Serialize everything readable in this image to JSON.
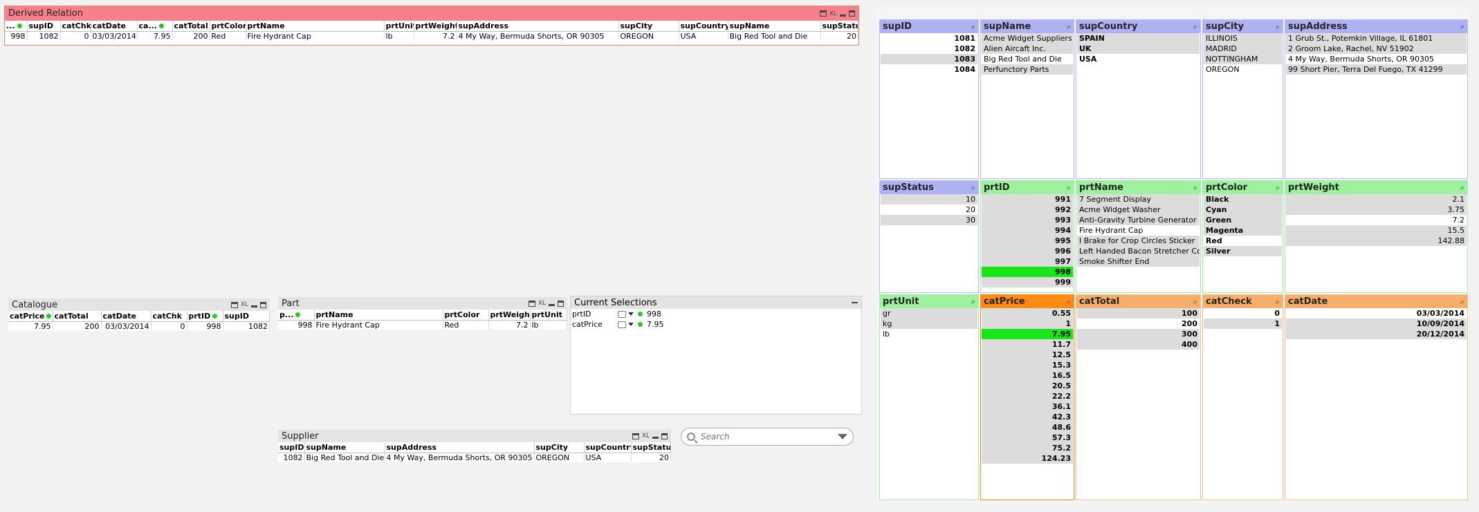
{
  "derived": {
    "title": "Derived Relation",
    "icons": "XL",
    "headers": [
      "...",
      "supID",
      "catChk",
      "catDate",
      "ca...",
      "catTotal",
      "prtColor",
      "prtName",
      "prtUnit",
      "prtWeight",
      "supAddress",
      "supCity",
      "supCountry",
      "supName",
      "supStatus"
    ],
    "row": [
      "998",
      "1082",
      "0",
      "03/03/2014",
      "7.95",
      "200",
      "Red",
      "Fire Hydrant Cap",
      "lb",
      "7.2",
      "4 My Way, Bermuda Shorts, OR 90305",
      "OREGON",
      "USA",
      "Big Red Tool and Die",
      "20"
    ]
  },
  "catalogue": {
    "title": "Catalogue",
    "icons": "XL",
    "headers": [
      "catPrice",
      "catTotal",
      "catDate",
      "catChk",
      "prtID",
      "supID"
    ],
    "row": [
      "7.95",
      "200",
      "03/03/2014",
      "0",
      "998",
      "1082"
    ]
  },
  "part": {
    "title": "Part",
    "icons": "XL",
    "headers": [
      "p...",
      "prtName",
      "prtColor",
      "prtWeight",
      "prtUnit"
    ],
    "row": [
      "998",
      "Fire Hydrant Cap",
      "Red",
      "7.2",
      "lb"
    ]
  },
  "supplier": {
    "title": "Supplier",
    "icons": "XL",
    "headers": [
      "supID",
      "supName",
      "supAddress",
      "supCity",
      "supCountry",
      "supStatus"
    ],
    "row": [
      "1082",
      "Big Red Tool and Die",
      "4 My Way, Bermuda Shorts, OR 90305",
      "OREGON",
      "USA",
      "20"
    ]
  },
  "current_selections": {
    "title": "Current Selections",
    "rows": [
      {
        "field": "prtID",
        "value": "998"
      },
      {
        "field": "catPrice",
        "value": "7.95"
      }
    ]
  },
  "search": {
    "placeholder": "Search"
  },
  "listboxes": {
    "supID": {
      "title": "supID",
      "items": [
        "1081",
        "1082",
        "1083",
        "1084"
      ]
    },
    "supName": {
      "title": "supName",
      "items": [
        "Acme Widget Suppliers",
        "Alien Aircaft Inc.",
        "Big Red Tool and Die",
        "Perfunctory Parts"
      ]
    },
    "supCountry": {
      "title": "supCountry",
      "items": [
        "SPAIN",
        "UK",
        "USA"
      ]
    },
    "supCity": {
      "title": "supCity",
      "items": [
        "ILLINOIS",
        "MADRID",
        "NOTTINGHAM",
        "OREGON"
      ]
    },
    "supAddress": {
      "title": "supAddress",
      "items": [
        "1 Grub St., Potemkin Village, IL 61801",
        "2 Groom Lake, Rachel, NV 51902",
        "4 My Way, Bermuda Shorts, OR 90305",
        "99 Short Pier, Terra Del Fuego, TX 41299"
      ]
    },
    "supStatus": {
      "title": "supStatus",
      "items": [
        "10",
        "20",
        "30"
      ]
    },
    "prtID": {
      "title": "prtID",
      "items": [
        "991",
        "992",
        "993",
        "994",
        "995",
        "996",
        "997",
        "998",
        "999"
      ]
    },
    "prtName": {
      "title": "prtName",
      "items": [
        "7 Segment Display",
        "Acme Widget Washer",
        "Anti-Gravity Turbine Generator",
        "Fire Hydrant Cap",
        "I Brake for Crop Circles Sticker",
        "Left Handed Bacon Stretcher Cover",
        "Smoke Shifter End"
      ]
    },
    "prtColor": {
      "title": "prtColor",
      "items": [
        "Black",
        "Cyan",
        "Green",
        "Magenta",
        "Red",
        "Silver"
      ]
    },
    "prtWeight": {
      "title": "prtWeight",
      "items": [
        "2.1",
        "3.75",
        "7.2",
        "15.5",
        "142.88"
      ]
    },
    "prtUnit": {
      "title": "prtUnit",
      "items": [
        "gr",
        "kg",
        "lb"
      ]
    },
    "catPrice": {
      "title": "catPrice",
      "items": [
        "0.55",
        "1",
        "7.95",
        "11.7",
        "12.5",
        "15.3",
        "16.5",
        "20.5",
        "22.2",
        "36.1",
        "42.3",
        "48.6",
        "57.3",
        "75.2",
        "124.23"
      ]
    },
    "catTotal": {
      "title": "catTotal",
      "items": [
        "100",
        "200",
        "300",
        "400"
      ]
    },
    "catCheck": {
      "title": "catCheck",
      "items": [
        "0",
        "1"
      ]
    },
    "catDate": {
      "title": "catDate",
      "items": [
        "03/03/2014",
        "10/09/2014",
        "20/12/2014"
      ]
    }
  },
  "colors": {
    "derived_caption": "#f5828a",
    "sup_caption": "#aeb2f3",
    "prt_caption": "#9ef29e",
    "cat_caption": "#f4b06a",
    "cat_selected_caption": "#ff8a14",
    "selected": "#19e619",
    "excluded": "#dcdcdc"
  }
}
